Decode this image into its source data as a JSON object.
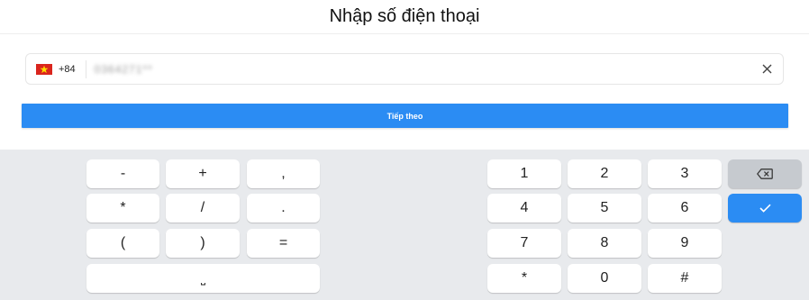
{
  "header": {
    "title": "Nhập số điện thoại"
  },
  "phone": {
    "country_flag": "vietnam-flag",
    "dial_code": "+84",
    "value": "0364271**",
    "clear_icon": "close-icon"
  },
  "primary_button": {
    "label": "Tiếp theo",
    "color": "#2b8cf3"
  },
  "keyboard": {
    "symbol_keys": [
      "-",
      "+",
      ",",
      "*",
      "/",
      ".",
      "(",
      ")",
      "="
    ],
    "space_key": "⎵",
    "numpad_keys": [
      "1",
      "2",
      "3",
      "4",
      "5",
      "6",
      "7",
      "8",
      "9",
      "*",
      "0",
      "#"
    ],
    "backspace_icon": "backspace-icon",
    "enter_icon": "check-icon",
    "background": "#e8eaed",
    "enter_color": "#2b8cf3"
  }
}
